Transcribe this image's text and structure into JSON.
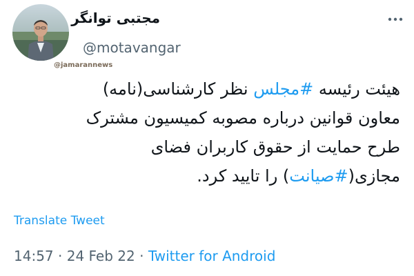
{
  "author": {
    "display_name": "مجتبی توانگر",
    "username": "@motavangar"
  },
  "watermark": "@jamarannews",
  "tweet": {
    "line1": {
      "pre": "هیئت رئیسه ",
      "hashtag": "#مجلس",
      "post": " نظر کارشناسی(نامه)"
    },
    "line2": "معاون قوانین درباره مصوبه کمیسیون مشترک",
    "line3": "طرح حمایت از حقوق کاربران فضای",
    "line4": {
      "pre": "مجازی(",
      "hashtag": "#صیانت",
      "post": ") را تایید کرد."
    }
  },
  "translate_label": "Translate Tweet",
  "meta": {
    "time": "14:57",
    "separator": "·",
    "date": "24 Feb 22",
    "source": "Twitter for Android"
  },
  "colors": {
    "link": "#1d9bf0",
    "text": "#0f1419",
    "secondary": "#536471"
  },
  "icons": {
    "more": "more-horizontal-icon",
    "avatar": "profile-photo"
  }
}
